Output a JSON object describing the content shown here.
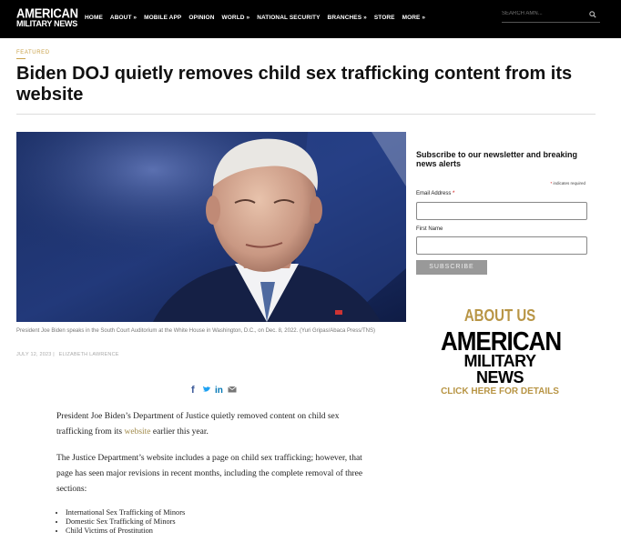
{
  "header": {
    "logo_line1": "AMERICAN",
    "logo_line2": "MILITARY NEWS",
    "nav": [
      "HOME",
      "ABOUT »",
      "MOBILE APP",
      "OPINION",
      "WORLD »",
      "NATIONAL SECURITY",
      "BRANCHES »",
      "STORE",
      "MORE »"
    ],
    "search_placeholder": "SEARCH AMN..."
  },
  "article": {
    "category": "FEATURED",
    "title": "Biden DOJ quietly removes child sex trafficking content from its website",
    "caption": "President Joe Biden speaks in the South Court Auditorium at the White House in Washington, D.C., on Dec. 8, 2022. (Yuri Gripas/Abaca Press/TNS)",
    "date": "JULY 12, 2023",
    "separator": "|",
    "author": "ELIZABETH LAWRENCE",
    "p1_before": "President Joe Biden’s Department of Justice quietly removed content on child sex trafficking from its ",
    "p1_link": "website",
    "p1_after": " earlier this year.",
    "p2": "The Justice Department’s website includes a page on child sex trafficking; however, that page has seen major revisions in recent months, including the complete removal of three sections:",
    "list": [
      "International Sex Trafficking of Minors",
      "Domestic Sex Trafficking of Minors",
      "Child Victims of Prostitution"
    ]
  },
  "newsletter": {
    "title": "Subscribe to our newsletter and breaking news alerts",
    "required_note": "indicates required",
    "required_star": "*",
    "email_label": "Email Address",
    "first_name_label": "First Name",
    "subscribe_label": "SUBSCRIBE"
  },
  "about_ad": {
    "heading": "ABOUT US",
    "brand_line1": "AMERICAN",
    "brand_line2": "MILITARY NEWS",
    "cta": "CLICK HERE FOR DETAILS"
  },
  "share_icons": [
    "facebook-icon",
    "twitter-icon",
    "linkedin-icon",
    "email-icon"
  ],
  "colors": {
    "accent_gold": "#c9a24a",
    "link": "#a08a4a",
    "topbar": "#000000",
    "facebook": "#3b5998",
    "twitter": "#1da1f2",
    "linkedin": "#0077b5"
  }
}
